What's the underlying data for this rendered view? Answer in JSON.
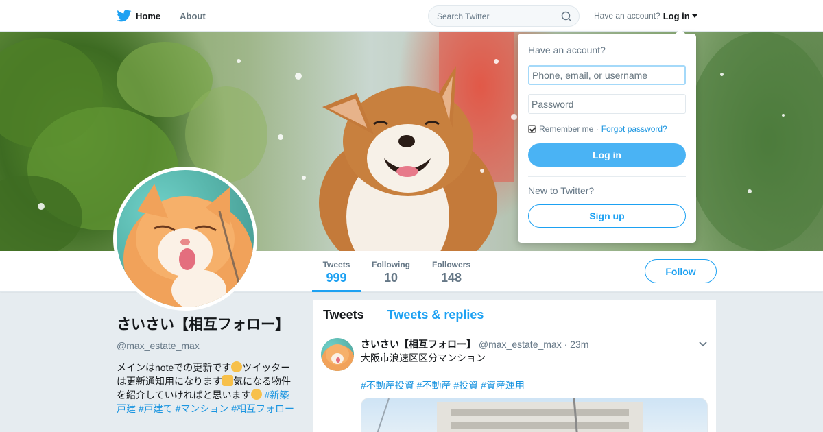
{
  "topnav": {
    "home_label": "Home",
    "about_label": "About",
    "search_placeholder": "Search Twitter",
    "have_account": "Have an account?",
    "login_label": "Log in"
  },
  "profile": {
    "name": "さいさい【相互フォロー】",
    "handle": "@max_estate_max",
    "bio_text_1": "メインはnoteでの更新です",
    "bio_text_2": "ツイッターは更新通知用になります",
    "bio_text_3": "気になる物件を紹介していければと思います",
    "bio_tags": "#新築戸建 #戸建て #マンション #相互フォロー"
  },
  "stats": [
    {
      "label": "Tweets",
      "value": "999"
    },
    {
      "label": "Following",
      "value": "10"
    },
    {
      "label": "Followers",
      "value": "148"
    }
  ],
  "follow_label": "Follow",
  "timeline": {
    "tabs": [
      "Tweets",
      "Tweets & replies"
    ],
    "tweet": {
      "name": "さいさい【相互フォロー】",
      "handle": "@max_estate_max",
      "time": "· 23m",
      "text": "大阪市浪速区区分マンション",
      "tags": "#不動産投資 #不動産 #投資 #資産運用"
    }
  },
  "login_dropdown": {
    "title": "Have an account?",
    "username_placeholder": "Phone, email, or username",
    "password_placeholder": "Password",
    "remember": "Remember me ·",
    "forgot": "Forgot password?",
    "login_button": "Log in",
    "new_to": "New to Twitter?",
    "signup_button": "Sign up"
  },
  "icons": {
    "logo": "twitter-bird-icon",
    "search": "search-icon",
    "caret": "caret-down-icon",
    "tweet_menu": "chevron-down-icon"
  },
  "colors": {
    "brand": "#1da1f2",
    "link": "#1b95e0",
    "muted": "#657786",
    "background": "#e6ecf0"
  }
}
